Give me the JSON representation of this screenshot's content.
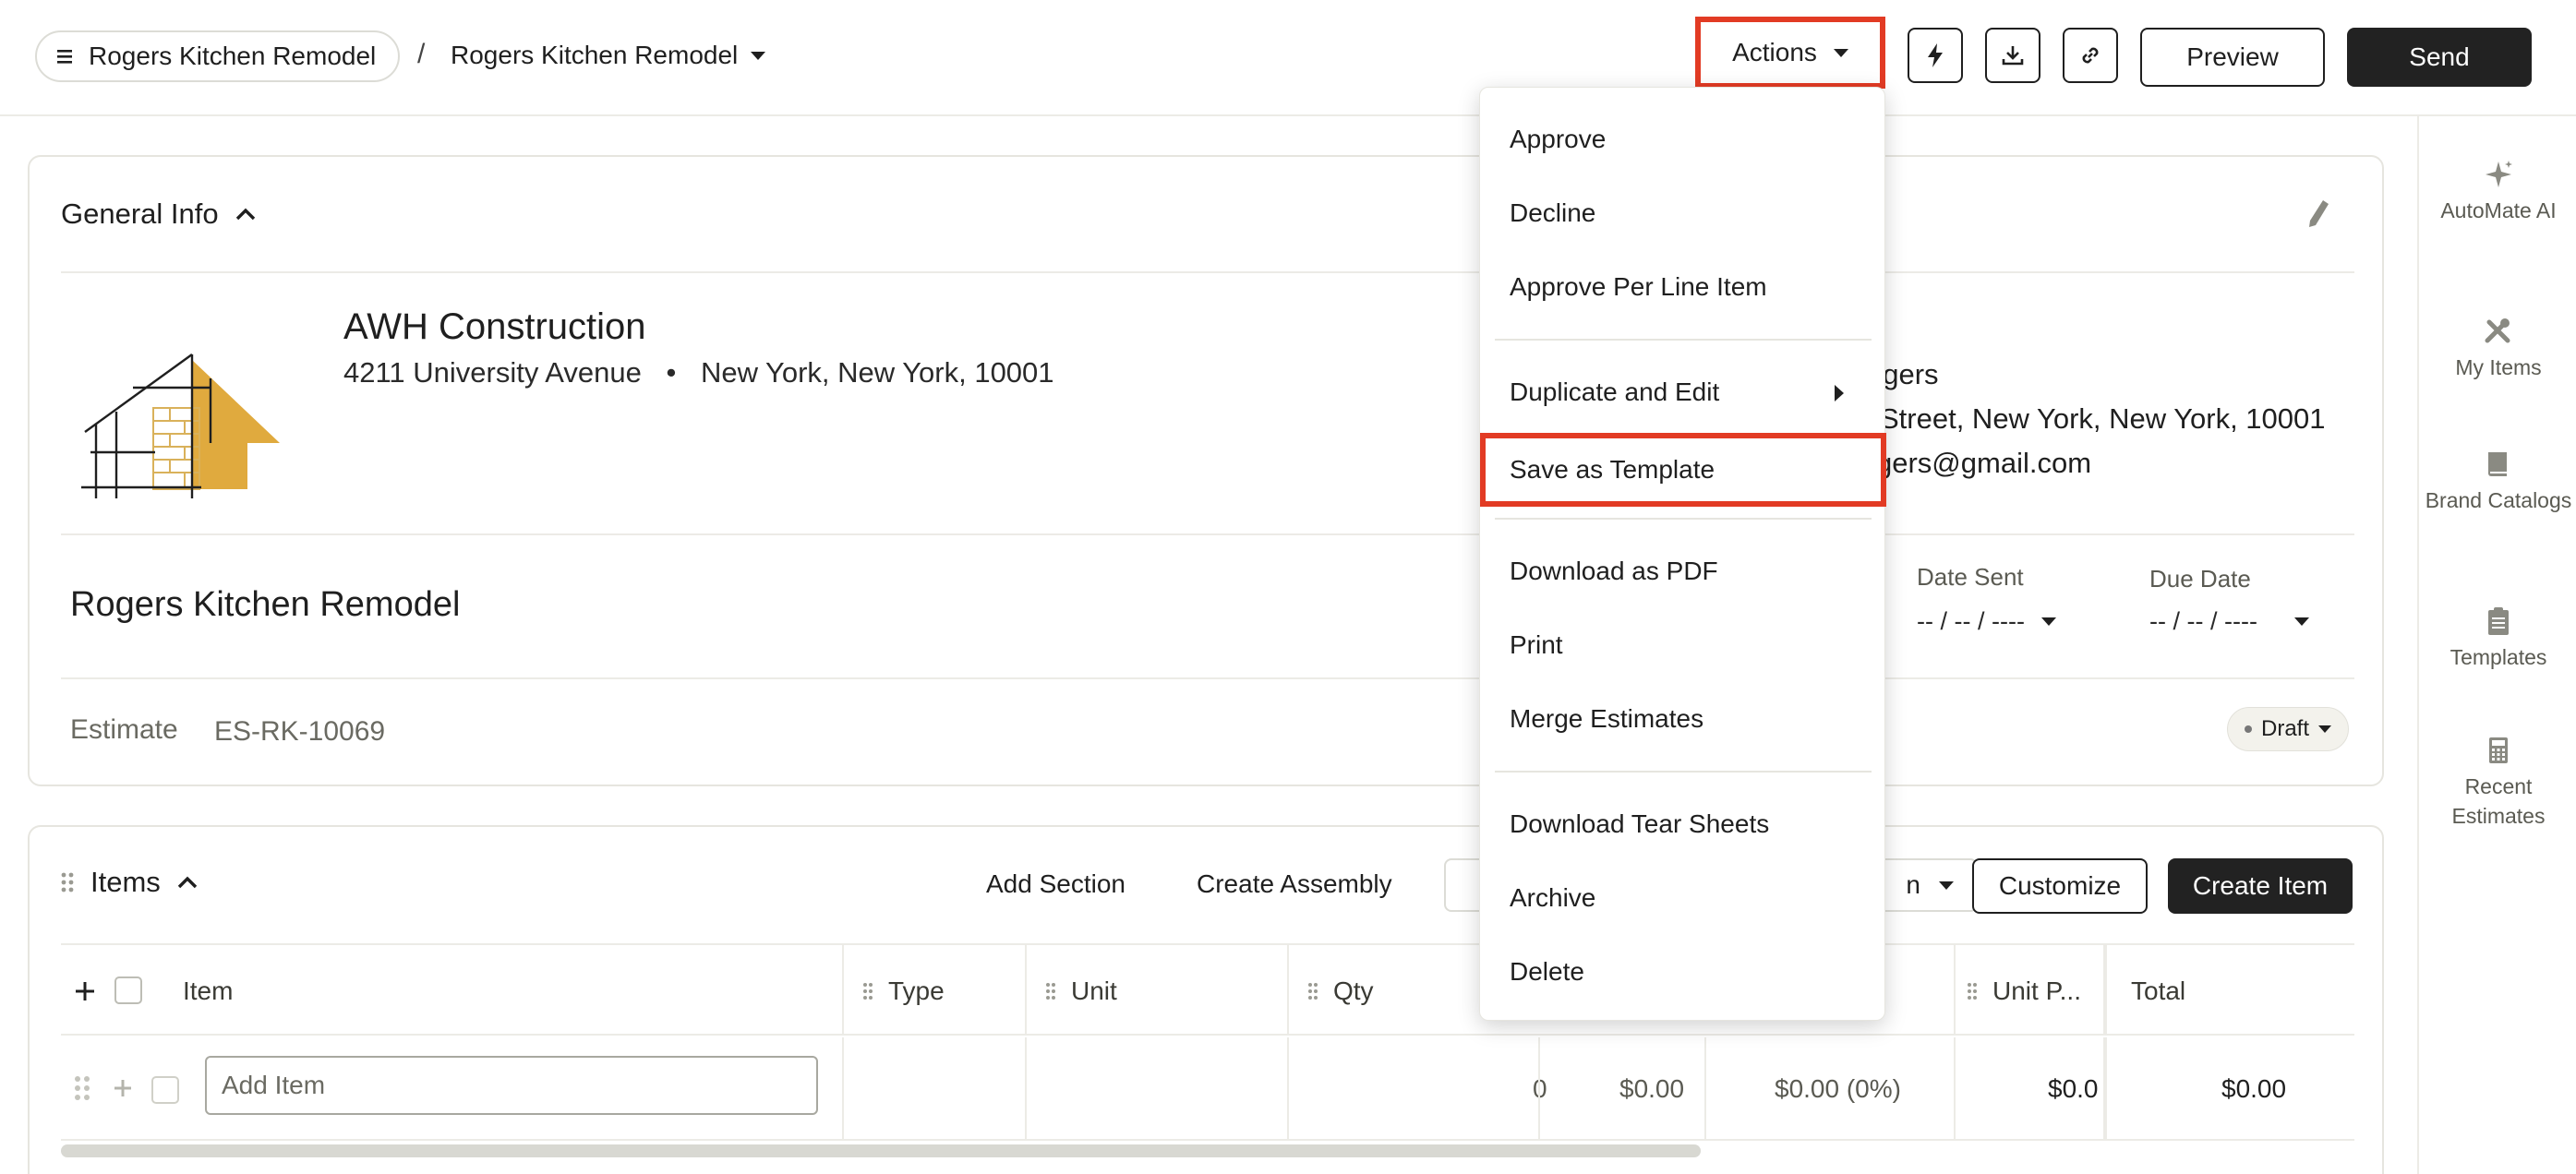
{
  "header": {
    "breadcrumb_root": "Rogers Kitchen Remodel",
    "breadcrumb_sep": "/",
    "breadcrumb_current": "Rogers Kitchen Remodel",
    "actions_label": "Actions",
    "preview_label": "Preview",
    "send_label": "Send",
    "icons": [
      "lightning-icon",
      "download-icon",
      "link-icon"
    ]
  },
  "actions_menu": {
    "items": [
      {
        "label": "Approve"
      },
      {
        "label": "Decline"
      },
      {
        "label": "Approve Per Line Item"
      },
      {
        "label": "Duplicate and Edit"
      },
      {
        "label": "Save as Template"
      },
      {
        "label": "Download as PDF"
      },
      {
        "label": "Print"
      },
      {
        "label": "Merge Estimates"
      },
      {
        "label": "Download Tear Sheets"
      },
      {
        "label": "Archive"
      },
      {
        "label": "Delete"
      }
    ],
    "highlighted": "Save as Template"
  },
  "general_info": {
    "title": "General Info",
    "company_name": "AWH Construction",
    "company_street": "4211 University Avenue",
    "company_bullet": "•",
    "company_city": "New York, New York, 10001",
    "client_name": "ogers",
    "client_address": "Street, New York, New York, 10001",
    "client_email": "gers@gmail.com",
    "project_title": "Rogers Kitchen Remodel",
    "date_sent_label": "Date Sent",
    "date_sent_value": "-- / -- / ----",
    "due_date_label": "Due Date",
    "due_date_value": "-- / -- / ----",
    "estimate_label": "Estimate",
    "estimate_number": "ES-RK-10069",
    "status": "Draft"
  },
  "items": {
    "title": "Items",
    "add_section": "Add Section",
    "create_assembly": "Create Assembly",
    "select_partial": "n",
    "customize": "Customize",
    "create_item": "Create Item",
    "columns": [
      "Item",
      "Type",
      "Unit",
      "Qty",
      "Unit P...",
      "Total"
    ],
    "row": {
      "add_item_placeholder": "Add Item",
      "qty": "0",
      "cost": "$0.00",
      "markup": "$0.00 (0%)",
      "unit_price": "$0.0",
      "total": "$0.00"
    }
  },
  "sidebar": {
    "items": [
      {
        "label": "AutoMate AI",
        "icon": "sparkle-icon"
      },
      {
        "label": "My Items",
        "icon": "tools-icon"
      },
      {
        "label": "Brand Catalogs",
        "icon": "book-icon"
      },
      {
        "label": "Templates",
        "icon": "clipboard-icon"
      },
      {
        "label": "Recent Estimates",
        "icon": "calculator-icon"
      }
    ]
  },
  "colors": {
    "highlight": "#e23b24",
    "dark_button": "#222222",
    "logo_gold": "#e0aa3e"
  }
}
